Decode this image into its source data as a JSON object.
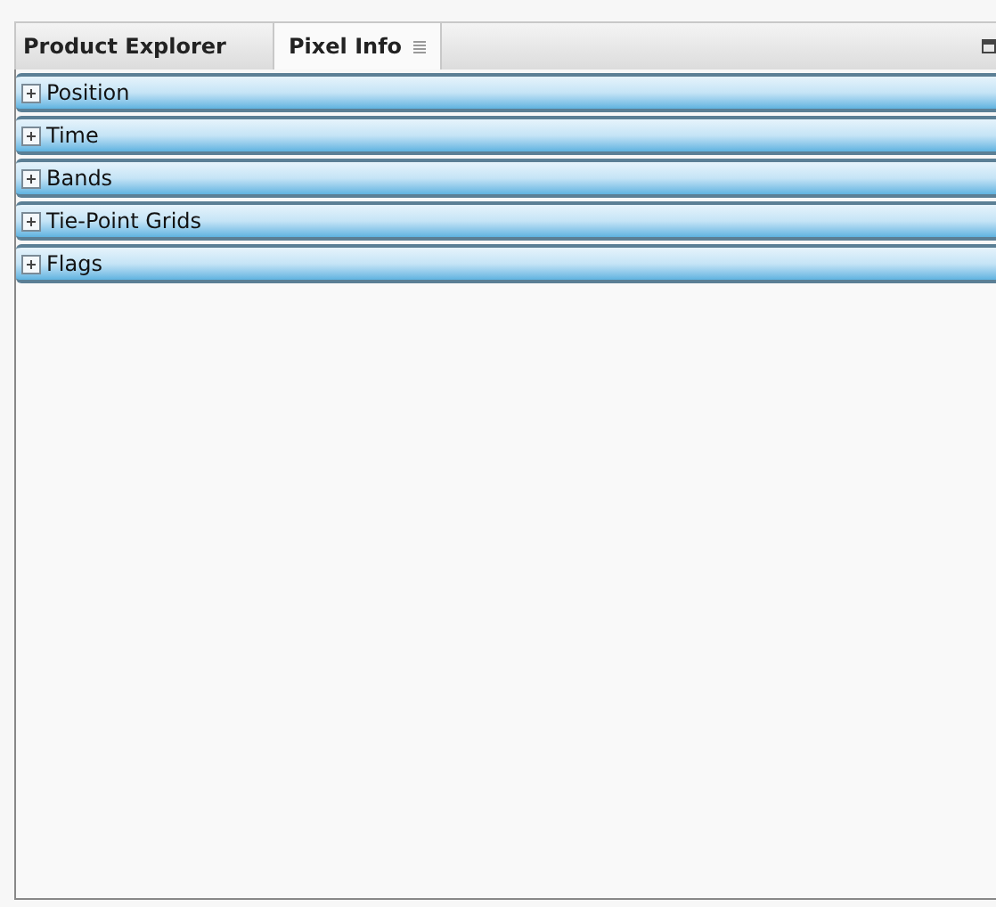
{
  "tabs": [
    {
      "label": "Product Explorer",
      "selected": false
    },
    {
      "label": "Pixel Info",
      "selected": true
    }
  ],
  "sections": [
    {
      "label": "Position",
      "expanded": false
    },
    {
      "label": "Time",
      "expanded": false
    },
    {
      "label": "Bands",
      "expanded": false
    },
    {
      "label": "Tie-Point Grids",
      "expanded": false
    },
    {
      "label": "Flags",
      "expanded": false
    }
  ]
}
